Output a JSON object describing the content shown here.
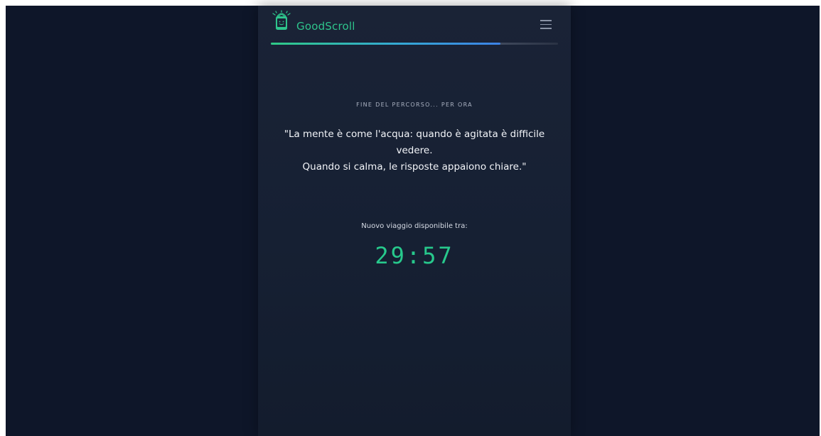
{
  "header": {
    "brand": "GoodScroll",
    "logo_icon": "phone-lotus-logo-icon",
    "menu_icon": "hamburger-menu-icon"
  },
  "progress": {
    "fraction": 0.8
  },
  "content": {
    "kicker": "FINE DEL PERCORSO... PER ORA",
    "quote_lines": [
      "\"La mente è come l'acqua: quando è agitata è difficile",
      "vedere.",
      "Quando si calma, le risposte appaiono chiare.\""
    ],
    "timer_label": "Nuovo viaggio disponibile tra:",
    "timer_value": "29:57"
  },
  "colors": {
    "accent_green": "#27c98c",
    "progress_blue": "#3c82e6",
    "background": "#0e1629",
    "panel": "#1a2336"
  }
}
